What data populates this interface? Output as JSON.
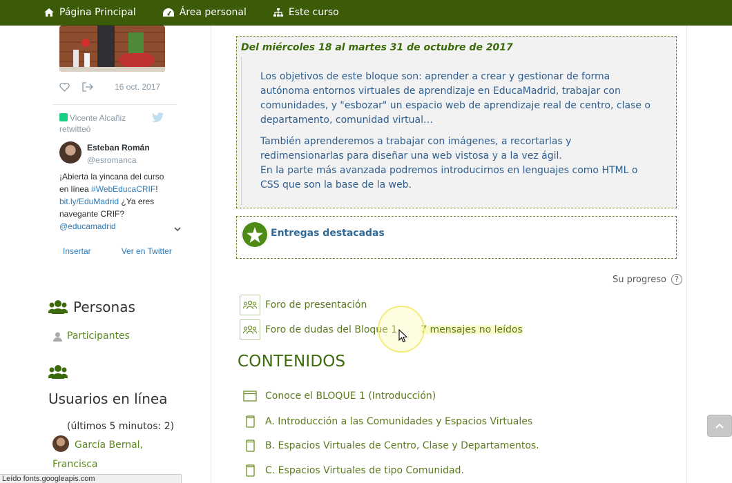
{
  "nav": {
    "home": "Página Principal",
    "personal": "Área personal",
    "course": "Este curso"
  },
  "twitter": {
    "date": "16 oct. 2017",
    "retweeter": "Vicente Alcañiz",
    "retweeted": "retwitteó",
    "author_name": "Esteban Román",
    "author_handle": "@esromanca",
    "text_1": "¡Abierta la yincana del curso en línea ",
    "hashtag": "#WebEducaCRIF",
    "text_2": "! ",
    "link": "bit.ly/EduMadrid",
    "text_3": " ¿Ya eres navegante CRIF? ",
    "mention": "@educamadrid",
    "embed_label": "Insertar",
    "view_label": "Ver en Twitter"
  },
  "people": {
    "title": "Personas",
    "participants": "Participantes"
  },
  "online": {
    "title": "Usuarios en línea",
    "meta": "(últimos 5 minutos: 2)",
    "user": "García Bernal, Francisca"
  },
  "status_bar": "Leído fonts.googleapis.com",
  "main": {
    "date_range": "Del miércoles 18 al martes 31 de octubre de 2017",
    "para_1": "Los objetivos de este bloque son: aprender a crear y gestionar de forma autónoma entornos virtuales de aprendizaje en EducaMadrid, trabajar con comunidades, y \"esbozar\" un espacio web de aprendizaje real de centro, clase o departamento, comunidad virtual…",
    "para_2": "También aprenderemos a trabajar con imágenes, a recortarlas y redimensionarlas para diseñar una web vistosa y a la vez ágil.",
    "para_3": "En la parte más avanzada podremos introducirnos en lenguajes como HTML o CSS que son la base de la web.",
    "highlight": "Entregas destacadas",
    "progress": "Su progreso",
    "forums": [
      {
        "label": "Foro de presentación"
      },
      {
        "label": "Foro de dudas del Bloque 1",
        "unread": "7 mensajes no leídos"
      }
    ],
    "section_title": "CONTENIDOS",
    "contents": [
      {
        "label": "Conoce el BLOQUE 1 (Introducción)"
      },
      {
        "label": "A. Introducción a las Comunidades y Espacios Virtuales"
      },
      {
        "label": "B. Espacios Virtuales de Centro, Clase y Departamentos."
      },
      {
        "label": "C. Espacios Virtuales de tipo Comunidad."
      }
    ]
  },
  "colors": {
    "nav_bg": "#3b5b08",
    "link_green": "#5b7a1d",
    "desc_blue": "#2f5e8d",
    "section_green": "#3b6a0a"
  }
}
